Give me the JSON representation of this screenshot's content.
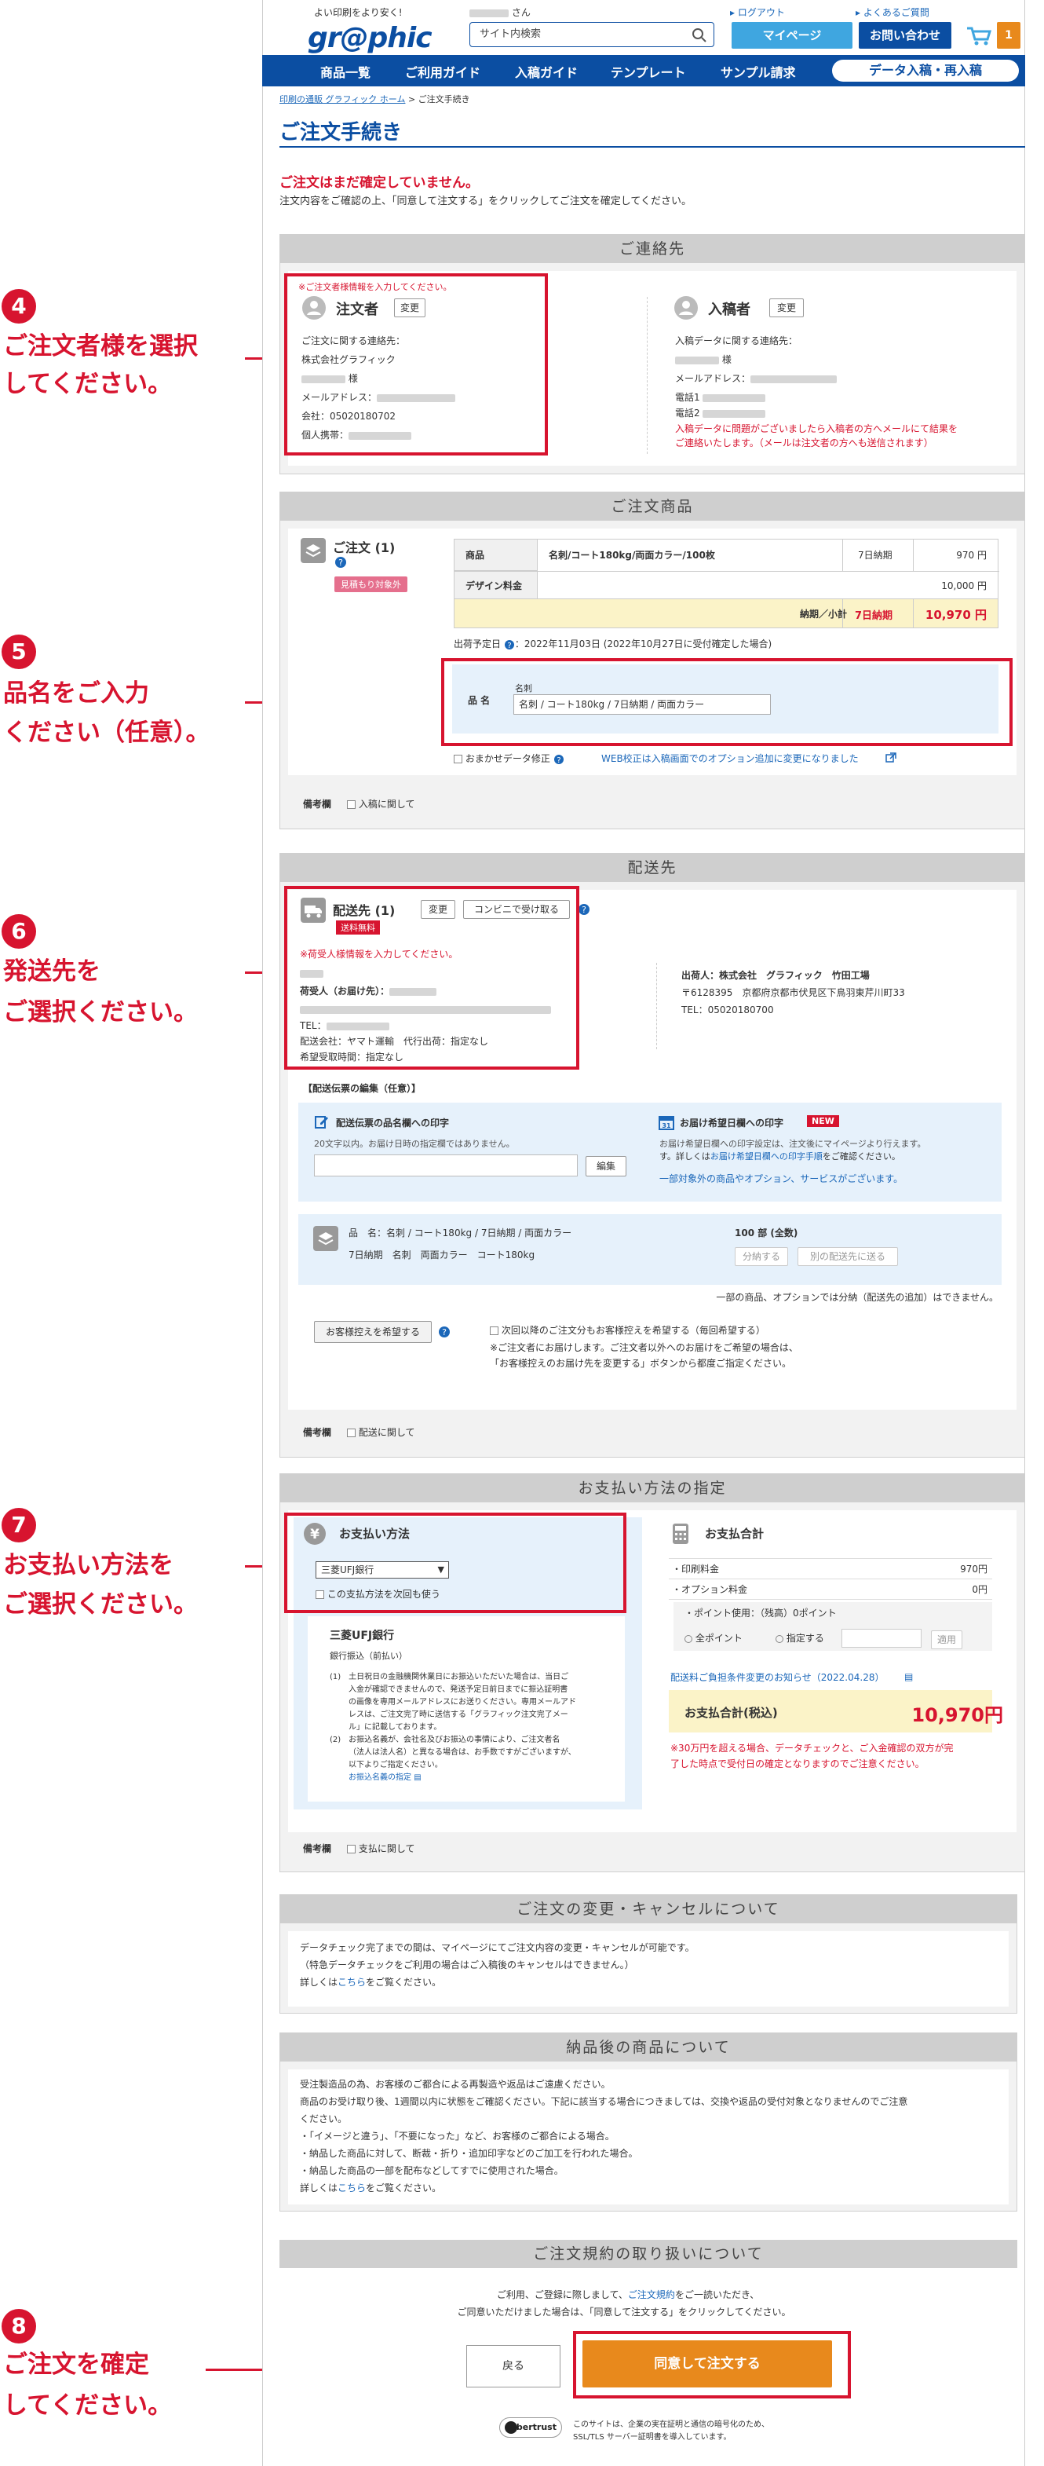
{
  "header": {
    "tagline": "よい印刷をより安く!",
    "logo": "gr@phic",
    "user_suffix": "さん",
    "search_placeholder": "サイト内検索",
    "logout": "ログアウト",
    "faq": "よくあるご質問",
    "mypage": "マイページ",
    "contact": "お問い合わせ",
    "cart_count": "1"
  },
  "nav": {
    "items": [
      "商品一覧",
      "ご利用ガイド",
      "入稿ガイド",
      "テンプレート",
      "サンプル請求"
    ],
    "data_upload": "データ入稿・再入稿"
  },
  "breadcrumb": {
    "home": "印刷の通販 グラフィック ホーム",
    "sep": ">",
    "current": "ご注文手続き"
  },
  "page_title": "ご注文手続き",
  "notice": {
    "title": "ご注文はまだ確定していません。",
    "text": "注文内容をご確認の上、「同意して注文する」をクリックしてご注文を確定してください。"
  },
  "annotations": [
    {
      "num": "4",
      "line1": "ご注文者様を選択",
      "line2": "してください。"
    },
    {
      "num": "5",
      "line1": "品名をご入力",
      "line2": "ください（任意）。"
    },
    {
      "num": "6",
      "line1": "発送先を",
      "line2": "ご選択ください。"
    },
    {
      "num": "7",
      "line1": "お支払い方法を",
      "line2": "ご選択ください。"
    },
    {
      "num": "8",
      "line1": "ご注文を確定",
      "line2": "してください。"
    }
  ],
  "contact": {
    "heading": "ご連絡先",
    "orderer_warn": "※ご注文者様情報を入力してください。",
    "orderer_title": "注文者",
    "change": "変更",
    "orderer_contact_label": "ご注文に関する連絡先：",
    "company": "株式会社グラフィック",
    "sama": "様",
    "email_label": "メールアドレス：",
    "company_tel": "会社：05020180702",
    "mobile_label": "個人携帯：",
    "submitter_title": "入稿者",
    "submitter_contact_label": "入稿データに関する連絡先：",
    "tel1_label": "電話1",
    "tel2_label": "電話2",
    "submitter_note1": "入稿データに問題がございましたら入稿者の方へメールにて結果を",
    "submitter_note2": "ご連絡いたします。（メールは注文者の方へも送信されます）"
  },
  "product": {
    "heading": "ご注文商品",
    "order_title": "ご注文 (1)",
    "quote_badge": "見積もり対象外",
    "row_label": "商品",
    "row_name": "名刺/コート180kg/両面カラー/100枚",
    "row_days": "7日納期",
    "row_price": "970 円",
    "design_label": "デザイン料金",
    "design_price": "10,000 円",
    "subtotal_label": "納期／小計",
    "subtotal_days": "7日納期",
    "subtotal_price": "10,970 円",
    "ship_date": "出荷予定日 ",
    "ship_date_value": "：2022年11月03日 (2022年10月27日に受付確定した場合)",
    "name_label": "品 名",
    "name_small": "名刺",
    "name_value": "名刺 / コート180kg / 7日納期 / 両面カラー",
    "omakase": "おまかせデータ修正",
    "web_notice": "WEB校正は入稿画面でのオプション追加に変更になりました",
    "remarks_label": "備考欄",
    "remarks_check": "入稿に関して"
  },
  "shipping": {
    "heading": "配送先",
    "title": "配送先 (1)",
    "change": "変更",
    "convenience": "コンビニで受け取る",
    "free": "送料無料",
    "warn": "※荷受人様情報を入力してください。",
    "consignee_label": "荷受人（お届け先）：",
    "tel_label": "TEL：",
    "company_label": "配送会社：ヤマト運輸　代行出荷：指定なし",
    "hope_time": "希望受取時間：指定なし",
    "sender_label": "出荷人：株式会社　グラフィック　竹田工場",
    "sender_addr": "〒6128395　京都府京都市伏見区下鳥羽東芹川町33",
    "sender_tel": "TEL：05020180700",
    "slip_heading": "【配送伝票の編集（任意）】",
    "slip_name_title": "配送伝票の品名欄への印字",
    "slip_name_note": "20文字以内。お届け日時の指定欄ではありません。",
    "edit_btn": "編集",
    "date_title": "お届け希望日欄への印字",
    "new_badge": "NEW",
    "date_note1": "お届け希望日欄への印字設定は、注文後にマイページより行えます。",
    "date_note2a": "す。詳しくは",
    "date_note2b": "お届け希望日欄への印字手順",
    "date_note2c": "をご確認ください。",
    "date_note3": "一部対象外の商品やオプション、サービスがございます。",
    "item_name": "品　名：名刺 / コート180kg / 7日納期 / 両面カラー",
    "item_sub": "7日納期　名刺　両面カラー　コート180kg",
    "item_qty": "100 部 (全数)",
    "split_btn": "分納する",
    "other_btn": "別の配送先に送る",
    "split_note": "一部の商品、オプションでは分納（配送先の追加）はできません。",
    "copy_btn": "お客様控えを希望する",
    "copy_check": "次回以降のご注文分もお客様控えを希望する（毎回希望する）",
    "copy_note1": "※ご注文者にお届けします。ご注文者以外へのお届けをご希望の場合は、",
    "copy_note2": "「お客様控えのお届け先を変更する」ボタンから都度ご指定ください。",
    "remarks_label": "備考欄",
    "remarks_check": "配送に関して"
  },
  "payment": {
    "heading": "お支払い方法の指定",
    "method_title": "お支払い方法",
    "selected": "三菱UFJ銀行",
    "next_check": "この支払方法を次回も使う",
    "bank_title": "三菱UFJ銀行",
    "bank_sub": "銀行振込（前払い）",
    "bank_note1a": "土日祝日の金融機関休業日にお振込いただいた場合は、当日ご",
    "bank_note1b": "入金が確認できませんので、発送予定日前日までに振込証明書",
    "bank_note1c": "の画像を専用メールアドレスにお送りください。専用メールアド",
    "bank_note1d": "レスは、ご注文完了時に送信する「グラフィック注文完了メー",
    "bank_note1e": "ル」に記載しております。",
    "bank_note2a": "お振込名義が、会社名及びお振込の事情により、ご注文者名",
    "bank_note2b": "（法人は法人名）と異なる場合は、お手数ですがございますが、",
    "bank_note2c": "以下よりご指定ください。",
    "bank_link": "お振込名義の指定",
    "total_title": "お支払合計",
    "print_fee": "・印刷料金",
    "print_fee_val": "970円",
    "option_fee": "・オプション料金",
    "option_fee_val": "0円",
    "points": "・ポイント使用：（残高）0ポイント",
    "all_points": "全ポイント",
    "specify": "指定する",
    "apply": "適用",
    "change_notice": "配送料ご負担条件変更のお知らせ（2022.04.28）",
    "grand_label": "お支払合計(税込)",
    "grand_val": "10,970円",
    "grand_note1": "※30万円を超える場合、データチェックと、ご入金確認の双方が完",
    "grand_note2": "了した時点で受付日の確定となりますのでご注意ください。",
    "remarks_label": "備考欄",
    "remarks_check": "支払に関して"
  },
  "change_cancel": {
    "heading": "ご注文の変更・キャンセルについて",
    "l1": "データチェック完了までの間は、マイページにてご注文内容の変更・キャンセルが可能です。",
    "l2": "（特急データチェックをご利用の場合はご入稿後のキャンセルはできません。）",
    "l3a": "詳しくは",
    "l3b": "こちら",
    "l3c": "をご覧ください。"
  },
  "after_delivery": {
    "heading": "納品後の商品について",
    "l1": "受注製造品の為、お客様のご都合による再製造や返品はご遠慮ください。",
    "l2": "商品のお受け取り後、1週間以内に状態をご確認ください。下記に該当する場合につきましては、交換や返品の受付対象となりませんのでご注意",
    "l3": "ください。",
    "l4": "・「イメージと違う」、「不要になった」など、お客様のご都合による場合。",
    "l5": "・納品した商品に対して、断裁・折り・追加印字などのご加工を行われた場合。",
    "l6": "・納品した商品の一部を配布などしてすでに使用された場合。",
    "l7a": "詳しくは",
    "l7b": "こちら",
    "l7c": "をご覧ください。"
  },
  "terms": {
    "heading": "ご注文規約の取り扱いについて",
    "l1a": "ご利用、ご登録に際しまして、",
    "l1b": "ご注文規約",
    "l1c": "をご一読いただき、",
    "l2": "ご同意いただけました場合は、「同意して注文する」をクリックしてください。",
    "back": "戻る",
    "agree": "同意して注文する"
  },
  "footer": {
    "cybertrust": "cybertrust",
    "ssl1": "このサイトは、企業の実在証明と通信の暗号化のため、",
    "ssl2": "SSL/TLS サーバー証明書を導入しています。"
  }
}
